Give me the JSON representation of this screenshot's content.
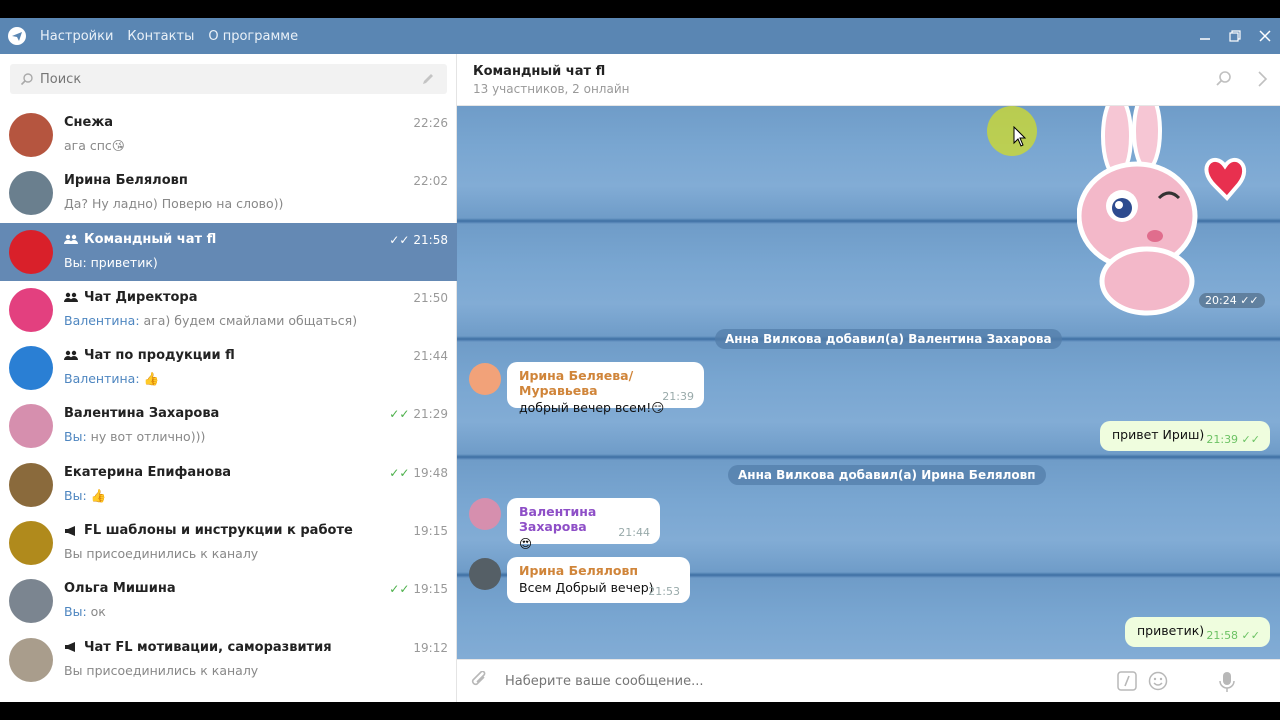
{
  "menu": [
    "Настройки",
    "Контакты",
    "О программе"
  ],
  "search": {
    "placeholder": "Поиск"
  },
  "chats": [
    {
      "name": "Снежа",
      "time": "22:26",
      "preview": "ага спс😘",
      "sender": "",
      "type": "person",
      "read": false,
      "active": false,
      "avatar_color": "#b5553f"
    },
    {
      "name": "Ирина Беляловп",
      "time": "22:02",
      "preview": "Да? Ну ладно) Поверю на слово))",
      "sender": "",
      "type": "person",
      "read": false,
      "active": false,
      "avatar_color": "#6a7f8e"
    },
    {
      "name": "Командный чат fl",
      "time": "21:58",
      "preview": "Вы: приветик)",
      "sender": "",
      "type": "group",
      "read": true,
      "active": true,
      "avatar_color": "#d9202a"
    },
    {
      "name": "Чат Директора",
      "time": "21:50",
      "preview": "ага) будем смайлами общаться)",
      "sender": "Валентина: ",
      "type": "group",
      "read": false,
      "active": false,
      "avatar_color": "#e3407f"
    },
    {
      "name": "Чат по продукции fl",
      "time": "21:44",
      "preview": "👍",
      "sender": "Валентина: ",
      "type": "group",
      "read": false,
      "active": false,
      "avatar_color": "#2a7fd4"
    },
    {
      "name": "Валентина Захарова",
      "time": "21:29",
      "preview": "ну вот отлично)))",
      "sender": "Вы: ",
      "type": "person",
      "read": true,
      "active": false,
      "avatar_color": "#d68fae"
    },
    {
      "name": "Екатерина Епифанова",
      "time": "19:48",
      "preview": "👍",
      "sender": "Вы: ",
      "type": "person",
      "read": true,
      "active": false,
      "avatar_color": "#8a6a3c"
    },
    {
      "name": "FL шаблоны и инструкции к работе",
      "time": "19:15",
      "preview": "Вы присоединились к каналу",
      "sender": "",
      "type": "channel",
      "read": false,
      "active": false,
      "avatar_color": "#b08a1c"
    },
    {
      "name": "Ольга Мишина",
      "time": "19:15",
      "preview": "ок",
      "sender": "Вы: ",
      "type": "person",
      "read": true,
      "active": false,
      "avatar_color": "#7b8590"
    },
    {
      "name": "Чат FL мотивации, саморазвития",
      "time": "19:12",
      "preview": "Вы присоединились к каналу",
      "sender": "",
      "type": "channel",
      "read": false,
      "active": false,
      "avatar_color": "#a99d8c"
    }
  ],
  "header": {
    "title": "Командный чат fl",
    "subtitle": "13 участников, 2 онлайн"
  },
  "sticker_time": "20:24",
  "service_1": "Анна Вилкова добавил(а) Валентина Захарова",
  "service_2": "Анна Вилкова добавил(а) Ирина Беляловп",
  "messages": [
    {
      "name": "Ирина Беляева/Муравьева",
      "name_color": "#d0853a",
      "text": "добрый вечер всем!😏",
      "time": "21:39"
    },
    {
      "text": "привет Ириш)",
      "time": "21:39"
    },
    {
      "name": "Валентина Захарова",
      "name_color": "#8e4fc7",
      "text": "😍",
      "time": "21:44"
    },
    {
      "name": "Ирина Беляловп",
      "name_color": "#d0853a",
      "text": "Всем Добрый вечер)",
      "time": "21:53"
    },
    {
      "text": "приветик)",
      "time": "21:58"
    }
  ],
  "composer": {
    "placeholder": "Наберите ваше сообщение..."
  }
}
